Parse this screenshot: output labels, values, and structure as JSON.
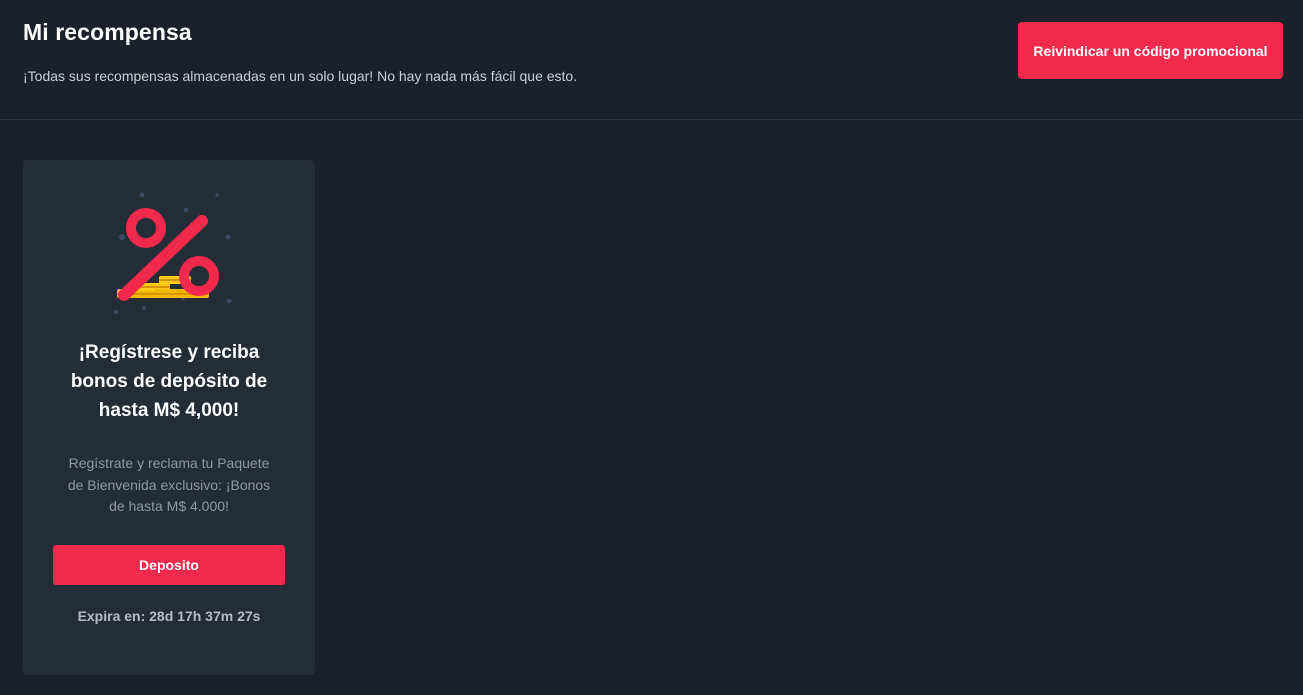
{
  "header": {
    "title": "Mi recompensa",
    "subtitle": "¡Todas sus recompensas almacenadas en un solo lugar! No hay nada más fácil que esto.",
    "promo_button_label": "Reivindicar un código promocional"
  },
  "reward_card": {
    "illustration_icon": "percent-coins-icon",
    "title_lines": [
      "¡Regístrese y reciba",
      "bonos de depósito de",
      "hasta M$ 4,000!"
    ],
    "description_lines": [
      "Regístrate y reclama tu Paquete",
      "de Bienvenida exclusivo: ¡Bonos",
      "de hasta M$ 4.000!"
    ],
    "deposit_button_label": "Deposito",
    "expiry_text": "Expira en: 28d 17h 37m 27s"
  },
  "colors": {
    "background": "#1a212a",
    "card": "#242c36",
    "accent": "#f1294c",
    "coin": "#f5b800"
  }
}
